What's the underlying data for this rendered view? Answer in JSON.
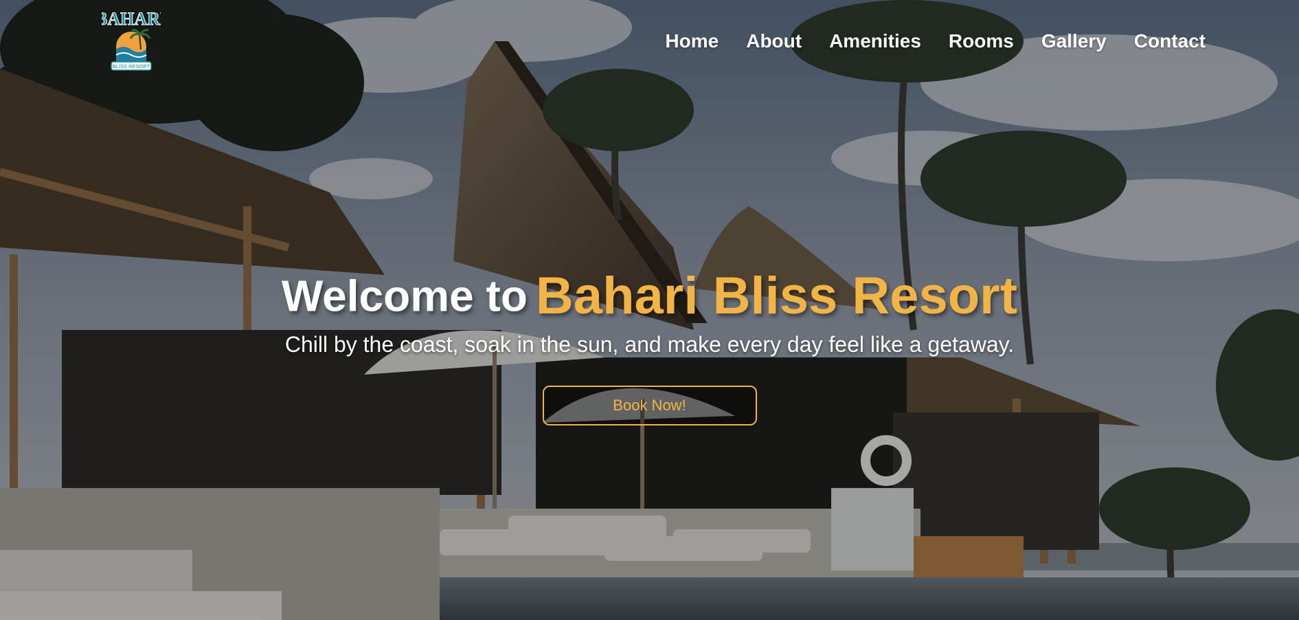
{
  "brand": {
    "logo_icon": "bahari-bliss-resort-logo",
    "accent_color": "#f2b545"
  },
  "nav": {
    "items": [
      {
        "label": "Home"
      },
      {
        "label": "About"
      },
      {
        "label": "Amenities"
      },
      {
        "label": "Rooms"
      },
      {
        "label": "Gallery"
      },
      {
        "label": "Contact"
      }
    ]
  },
  "hero": {
    "headline_prefix": "Welcome to",
    "headline_highlight": "Bahari Bliss Resort",
    "tagline": "Chill by the coast, soak in the sun, and make every day feel like a getaway.",
    "cta_label": "Book Now!",
    "background_image": "tropical-resort-with-thatched-huts-palm-trees-infinity-pool"
  }
}
